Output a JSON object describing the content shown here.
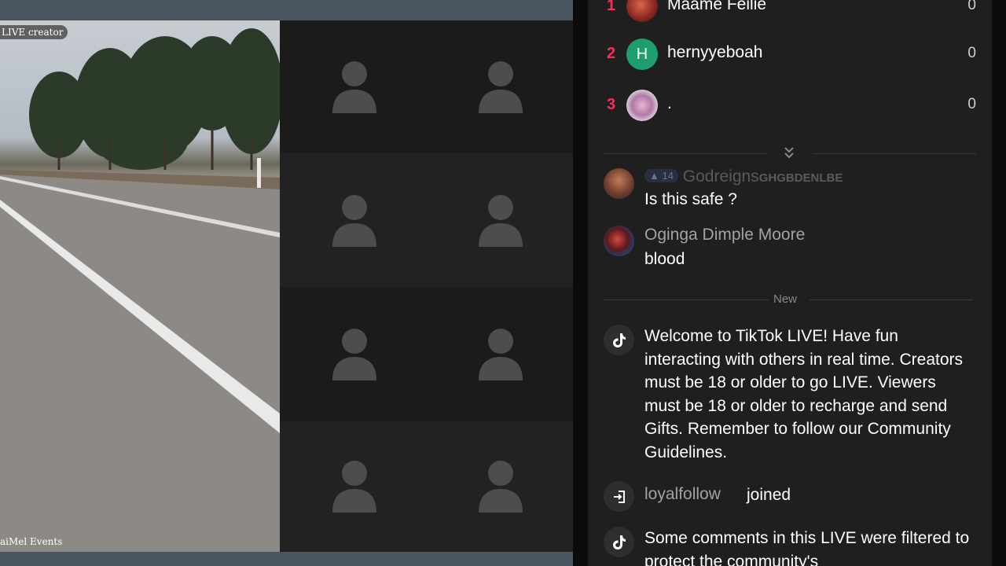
{
  "stream": {
    "creator_badge": "LIVE creator",
    "footer": "aiMel Events"
  },
  "leaderboard": [
    {
      "rank": "1",
      "name": "Maame Feilie",
      "score": "0",
      "avatar_color": "#a33a2c"
    },
    {
      "rank": "2",
      "name": "hernyyeboah",
      "score": "0",
      "avatar_letter": "H",
      "avatar_color": "#1e9e6e"
    },
    {
      "rank": "3",
      "name": ".",
      "score": "0",
      "avatar_color": "#c9a9c7"
    }
  ],
  "chat": {
    "new_label": "New",
    "messages": [
      {
        "user": "Godreigns",
        "user_suffix": "GHGBDENLBE",
        "level": "14",
        "text": "Is this safe ?"
      },
      {
        "user": "Oginga Dimple Moore",
        "text": "blood"
      }
    ],
    "system_welcome": "Welcome to TikTok LIVE! Have fun interacting with others in real time. Creators must be 18 or older to go LIVE. Viewers must be 18 or older to recharge and send Gifts. Remember to follow our Community Guidelines.",
    "join_user": "loyalfollow",
    "join_text": "joined",
    "system_filtered": "Some comments in this LIVE were filtered to protect the community's"
  },
  "colors": {
    "accent": "#fe2c55",
    "panel_bg": "#1f1f1f"
  },
  "icons": [
    "person-placeholder-icon",
    "tiktok-icon",
    "join-icon",
    "chevron-down-icon"
  ]
}
